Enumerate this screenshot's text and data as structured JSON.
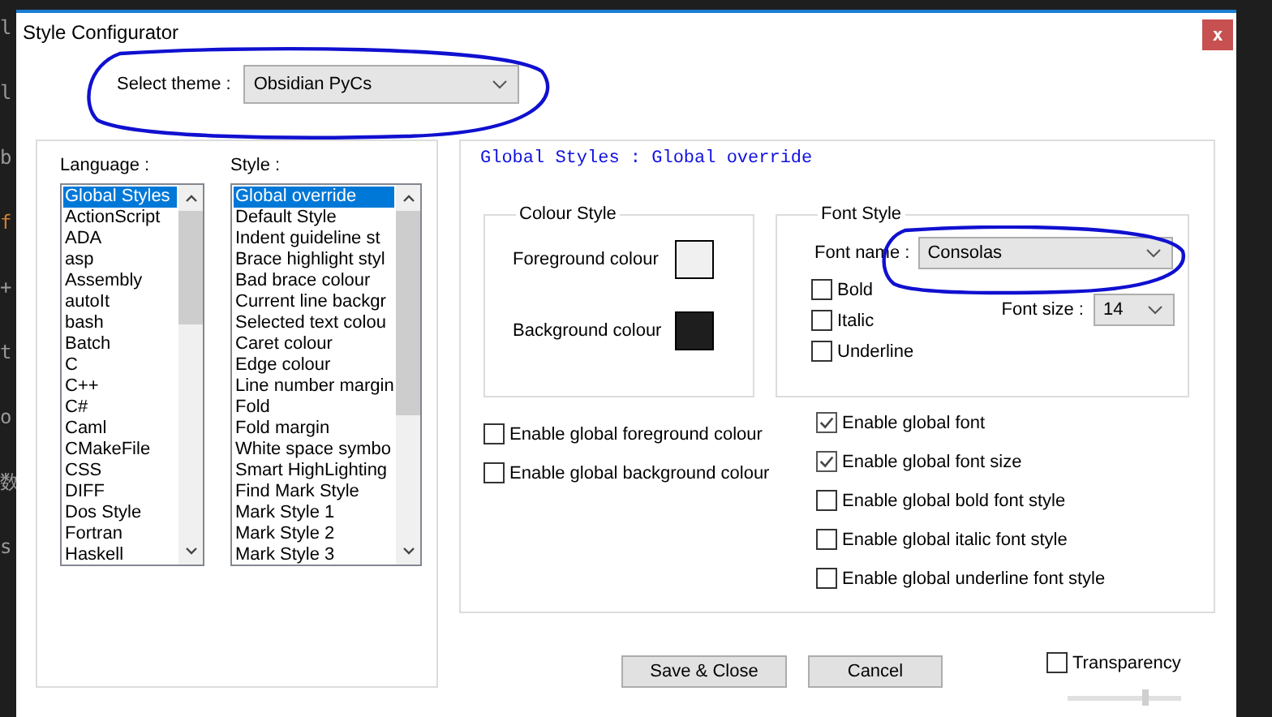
{
  "editor_fragments": [
    "l",
    "l",
    "b",
    "f",
    "+",
    "t",
    "o",
    "数",
    "s"
  ],
  "window": {
    "title": "Style Configurator",
    "close": "x"
  },
  "theme": {
    "label": "Select theme :",
    "value": "Obsidian PyCs"
  },
  "language": {
    "label": "Language :",
    "items": [
      {
        "label": "Global Styles",
        "selected": true
      },
      {
        "label": "ActionScript",
        "selected": false
      },
      {
        "label": "ADA",
        "selected": false
      },
      {
        "label": "asp",
        "selected": false
      },
      {
        "label": "Assembly",
        "selected": false
      },
      {
        "label": "autoIt",
        "selected": false
      },
      {
        "label": "bash",
        "selected": false
      },
      {
        "label": "Batch",
        "selected": false
      },
      {
        "label": "C",
        "selected": false
      },
      {
        "label": "C++",
        "selected": false
      },
      {
        "label": "C#",
        "selected": false
      },
      {
        "label": "Caml",
        "selected": false
      },
      {
        "label": "CMakeFile",
        "selected": false
      },
      {
        "label": "CSS",
        "selected": false
      },
      {
        "label": "DIFF",
        "selected": false
      },
      {
        "label": "Dos Style",
        "selected": false
      },
      {
        "label": "Fortran",
        "selected": false
      },
      {
        "label": "Haskell",
        "selected": false
      }
    ]
  },
  "style": {
    "label": "Style :",
    "items": [
      {
        "label": "Global override",
        "selected": true
      },
      {
        "label": "Default Style",
        "selected": false
      },
      {
        "label": "Indent guideline st",
        "selected": false
      },
      {
        "label": "Brace highlight styl",
        "selected": false
      },
      {
        "label": "Bad brace colour",
        "selected": false
      },
      {
        "label": "Current line backgr",
        "selected": false
      },
      {
        "label": "Selected text colou",
        "selected": false
      },
      {
        "label": "Caret colour",
        "selected": false
      },
      {
        "label": "Edge colour",
        "selected": false
      },
      {
        "label": "Line number margin",
        "selected": false
      },
      {
        "label": "Fold",
        "selected": false
      },
      {
        "label": "Fold margin",
        "selected": false
      },
      {
        "label": "White space symbo",
        "selected": false
      },
      {
        "label": "Smart HighLighting",
        "selected": false
      },
      {
        "label": "Find Mark Style",
        "selected": false
      },
      {
        "label": "Mark Style 1",
        "selected": false
      },
      {
        "label": "Mark Style 2",
        "selected": false
      },
      {
        "label": "Mark Style 3",
        "selected": false
      }
    ]
  },
  "heading": "Global Styles : Global override",
  "colour_style": {
    "title": "Colour Style",
    "swatches": [
      {
        "label": "Foreground colour",
        "color": "#f0f0f0"
      },
      {
        "label": "Background colour",
        "color": "#1e1e1e"
      }
    ]
  },
  "font_style": {
    "title": "Font Style",
    "name_label": "Font name :",
    "name": "Consolas",
    "size_label": "Font size :",
    "size": "14",
    "options": [
      {
        "label": "Bold",
        "checked": false
      },
      {
        "label": "Italic",
        "checked": false
      },
      {
        "label": "Underline",
        "checked": false
      }
    ]
  },
  "global_colour_options": [
    {
      "label": "Enable global foreground colour",
      "checked": false
    },
    {
      "label": "Enable global background colour",
      "checked": false
    }
  ],
  "global_font_options": [
    {
      "label": "Enable global font",
      "checked": true
    },
    {
      "label": "Enable global font size",
      "checked": true
    },
    {
      "label": "Enable global bold font style",
      "checked": false
    },
    {
      "label": "Enable global italic font style",
      "checked": false
    },
    {
      "label": "Enable global underline font style",
      "checked": false
    }
  ],
  "buttons": [
    "Save & Close",
    "Cancel"
  ],
  "transparency": {
    "label": "Transparency",
    "checked": false,
    "level": 0.7
  }
}
